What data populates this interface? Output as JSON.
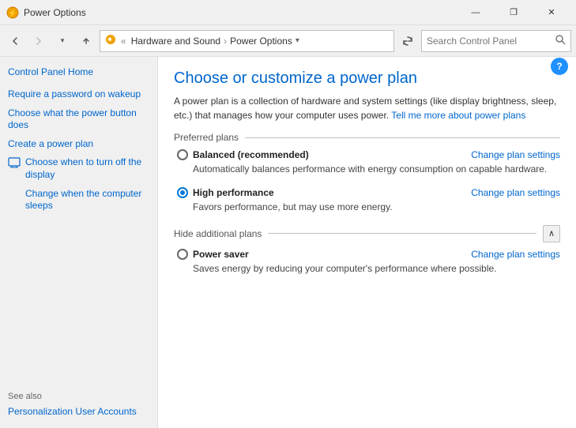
{
  "window": {
    "title": "Power Options",
    "icon": "⚡"
  },
  "titlebar": {
    "minimize_label": "—",
    "restore_label": "❐",
    "close_label": "✕"
  },
  "addressbar": {
    "back_title": "←",
    "forward_title": "→",
    "up_title": "↑",
    "breadcrumb_icon": "⚡",
    "breadcrumb_separator": "«",
    "breadcrumb_parent": "Hardware and Sound",
    "breadcrumb_arrow": "›",
    "breadcrumb_current": "Power Options",
    "chevron": "˅",
    "refresh_title": "⟳",
    "search_placeholder": "Search Control Panel",
    "search_icon": "🔍"
  },
  "sidebar": {
    "home_label": "Control Panel Home",
    "links": [
      {
        "id": "require-password",
        "label": "Require a password on wakeup",
        "icon": false
      },
      {
        "id": "power-button",
        "label": "Choose what the power button does",
        "icon": false
      },
      {
        "id": "create-plan",
        "label": "Create a power plan",
        "icon": false
      },
      {
        "id": "turn-off-display",
        "label": "Choose when to turn off the display",
        "icon": true,
        "icon_type": "monitor"
      },
      {
        "id": "computer-sleeps",
        "label": "Change when the computer sleeps",
        "icon": true,
        "icon_type": "moon"
      }
    ],
    "see_also_label": "See also",
    "footer_links": [
      {
        "id": "personalization",
        "label": "Personalization"
      },
      {
        "id": "user-accounts",
        "label": "User Accounts"
      }
    ]
  },
  "content": {
    "title": "Choose or customize a power plan",
    "description": "A power plan is a collection of hardware and system settings (like display brightness, sleep, etc.) that manages how your computer uses power.",
    "more_link": "Tell me more about power plans",
    "preferred_section_label": "Preferred plans",
    "plans": [
      {
        "id": "balanced",
        "name": "Balanced (recommended)",
        "selected": false,
        "description": "Automatically balances performance with energy consumption on capable hardware.",
        "change_link": "Change plan settings"
      },
      {
        "id": "high-performance",
        "name": "High performance",
        "selected": true,
        "description": "Favors performance, but may use more energy.",
        "change_link": "Change plan settings"
      }
    ],
    "additional_section_label": "Hide additional plans",
    "additional_plans": [
      {
        "id": "power-saver",
        "name": "Power saver",
        "selected": false,
        "description": "Saves energy by reducing your computer's performance where possible.",
        "change_link": "Change plan settings"
      }
    ]
  }
}
